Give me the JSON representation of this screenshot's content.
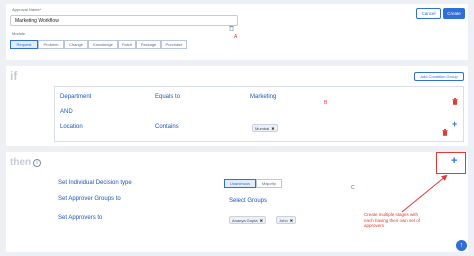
{
  "approval_name": {
    "label": "Approval Name",
    "required": "*",
    "value": "Marketing Workflow"
  },
  "header_buttons": {
    "cancel": "Cancel",
    "create": "Create"
  },
  "module": {
    "label": "Module",
    "tabs": [
      "Request",
      "Problem",
      "Change",
      "Knowledge",
      "Patch",
      "Package",
      "Purchase"
    ],
    "selected": "Request"
  },
  "markers": {
    "a": "A",
    "b": "B",
    "c": "C"
  },
  "if_section": {
    "heading": "if",
    "add_condition_group": "Add Condition Group",
    "row1": {
      "field": "Department",
      "operator": "Equals to",
      "value": "Marketing"
    },
    "joiner": "AND",
    "row2": {
      "field": "Location",
      "operator": "Contains",
      "chip": "Mumbai"
    }
  },
  "then_section": {
    "heading": "then",
    "decision_type": {
      "label": "Set Individual Decision type",
      "options": [
        "Unanimous",
        "Majority"
      ],
      "selected": "Unanimous"
    },
    "approver_groups": {
      "label": "Set Approver Groups to",
      "placeholder": "Select Groups"
    },
    "approvers": {
      "label": "Set Approvers to",
      "chips": [
        "Ananya Gupta",
        "John"
      ]
    },
    "plus": "+"
  },
  "annotation": {
    "text": "Create multiple stages with each having their own set of approvers",
    "color": "#e53935"
  },
  "colors": {
    "accent": "#2f6fd6",
    "link_text": "#1f56b8",
    "delete": "#e53935",
    "annotation": "#e53935"
  }
}
